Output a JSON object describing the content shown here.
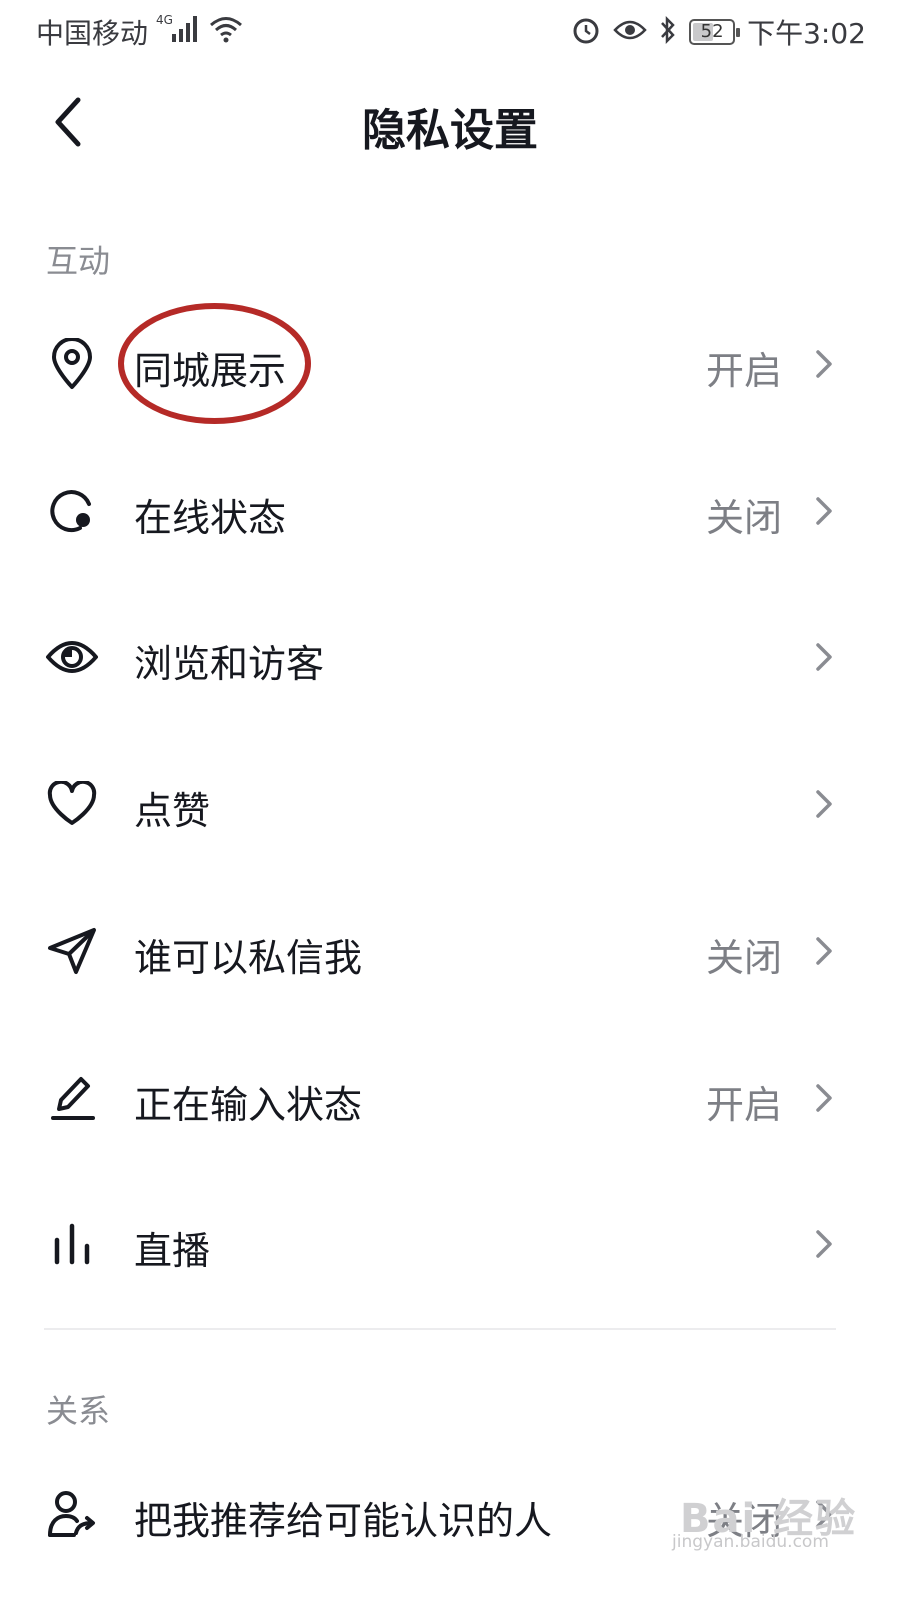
{
  "status_bar": {
    "carrier": "中国移动",
    "network": "4G",
    "battery": "52",
    "battery_level": 52,
    "time": "下午3:02"
  },
  "header": {
    "title": "隐私设置"
  },
  "sections": [
    {
      "title": "互动",
      "items": [
        {
          "label": "同城展示",
          "value": "开启",
          "icon": "location-pin-icon"
        },
        {
          "label": "在线状态",
          "value": "关闭",
          "icon": "online-status-icon"
        },
        {
          "label": "浏览和访客",
          "value": "",
          "icon": "eye-icon"
        },
        {
          "label": "点赞",
          "value": "",
          "icon": "heart-icon"
        },
        {
          "label": "谁可以私信我",
          "value": "关闭",
          "icon": "paper-plane-icon"
        },
        {
          "label": "正在输入状态",
          "value": "开启",
          "icon": "pencil-icon"
        },
        {
          "label": "直播",
          "value": "",
          "icon": "bar-chart-icon"
        }
      ]
    },
    {
      "title": "关系",
      "items": [
        {
          "label": "把我推荐给可能认识的人",
          "value": "关闭",
          "icon": "user-share-icon"
        }
      ]
    }
  ],
  "watermark": {
    "text": "Bai 经验",
    "sub": "jingyan.baidu.com"
  }
}
